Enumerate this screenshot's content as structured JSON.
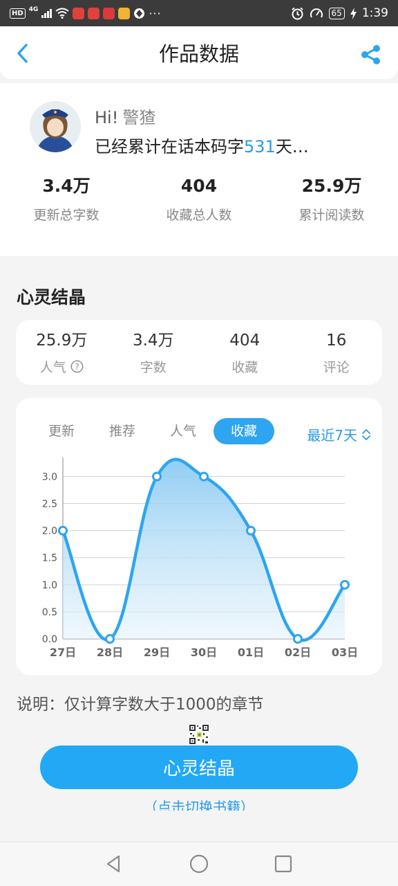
{
  "status_bar": {
    "hd": "HD",
    "network": "4G",
    "dots": "···",
    "battery": "65",
    "time": "1:39"
  },
  "nav": {
    "title": "作品数据",
    "back_icon": "chevron-left-icon",
    "share_icon": "share-icon"
  },
  "profile": {
    "greeting": "Hi!",
    "username": "警猹",
    "days_prefix": "已经累计在话本码字",
    "days": "531",
    "days_suffix": "天…",
    "stats": [
      {
        "value": "3.4万",
        "label": "更新总字数"
      },
      {
        "value": "404",
        "label": "收藏总人数"
      },
      {
        "value": "25.9万",
        "label": "累计阅读数"
      }
    ]
  },
  "section": {
    "title": "心灵结晶"
  },
  "summary": [
    {
      "value": "25.9万",
      "label": "人气",
      "has_help": true
    },
    {
      "value": "3.4万",
      "label": "字数"
    },
    {
      "value": "404",
      "label": "收藏"
    },
    {
      "value": "16",
      "label": "评论"
    }
  ],
  "chart": {
    "tabs": [
      "更新",
      "推荐",
      "人气",
      "收藏"
    ],
    "active_tab": "收藏",
    "range": "最近7天",
    "accent": "#2ea5f0"
  },
  "chart_data": {
    "type": "area",
    "categories": [
      "27日",
      "28日",
      "29日",
      "30日",
      "01日",
      "02日",
      "03日"
    ],
    "series": [
      {
        "values": [
          2,
          0,
          3,
          3,
          2,
          0,
          1
        ]
      }
    ],
    "yticks": [
      "0.0",
      "0.5",
      "1.0",
      "1.5",
      "2.0",
      "2.5",
      "3.0"
    ],
    "ylim": [
      0,
      3.3
    ],
    "grid": true,
    "title": "",
    "xlabel": "",
    "ylabel": ""
  },
  "note": "说明：仅计算字数大于1000的章节",
  "main_button": "心灵结晶",
  "switch_link": "（点击切换书籍）",
  "colors": {
    "accent": "#2ea5f0",
    "button": "#22a8f5",
    "highlight_text": "#2a9be8"
  }
}
